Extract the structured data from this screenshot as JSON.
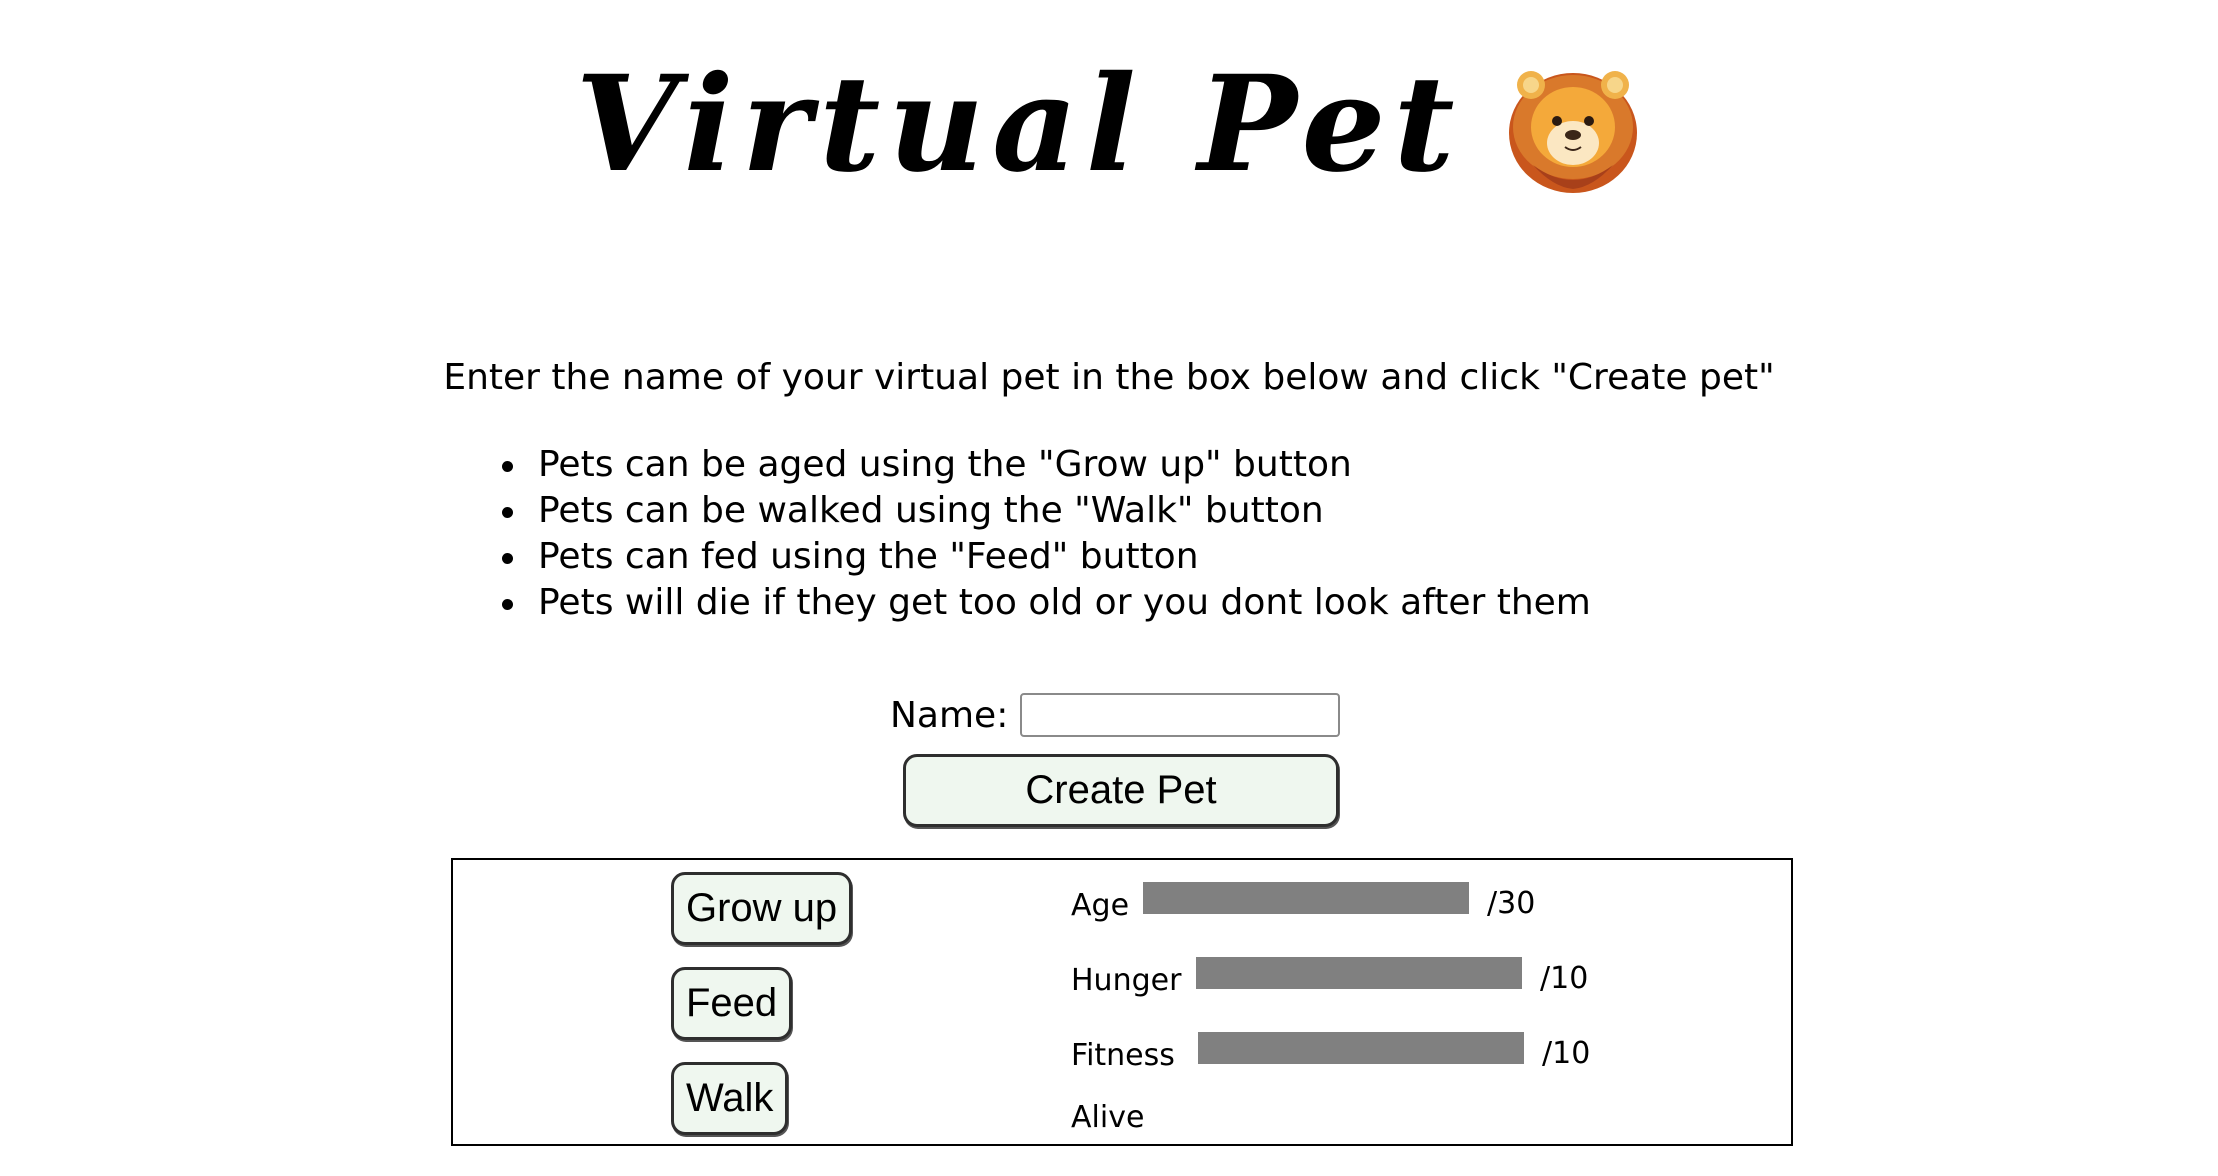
{
  "header": {
    "title": "Virtual Pet",
    "emoji_icon": "lion-face-icon"
  },
  "instructions": {
    "intro": "Enter the name of your virtual pet in the box below and click \"Create pet\"",
    "rules": [
      "Pets can be aged using the \"Grow up\" button",
      "Pets can be walked using the \"Walk\" button",
      "Pets can fed using the \"Feed\" button",
      "Pets will die if they get too old or you dont look after them"
    ]
  },
  "form": {
    "name_label": "Name:",
    "name_value": "",
    "name_placeholder": "",
    "create_button": "Create Pet"
  },
  "actions": {
    "grow_up": "Grow up",
    "feed": "Feed",
    "walk": "Walk"
  },
  "stats": {
    "age": {
      "label": "Age",
      "max": "/30",
      "fill_fraction": 1.0
    },
    "hunger": {
      "label": "Hunger",
      "max": "/10",
      "fill_fraction": 1.0
    },
    "fitness": {
      "label": "Fitness",
      "max": "/10",
      "fill_fraction": 1.0
    },
    "status": "Alive"
  },
  "colors": {
    "button_bg": "#eff7ef",
    "bar_fill": "#808080"
  }
}
